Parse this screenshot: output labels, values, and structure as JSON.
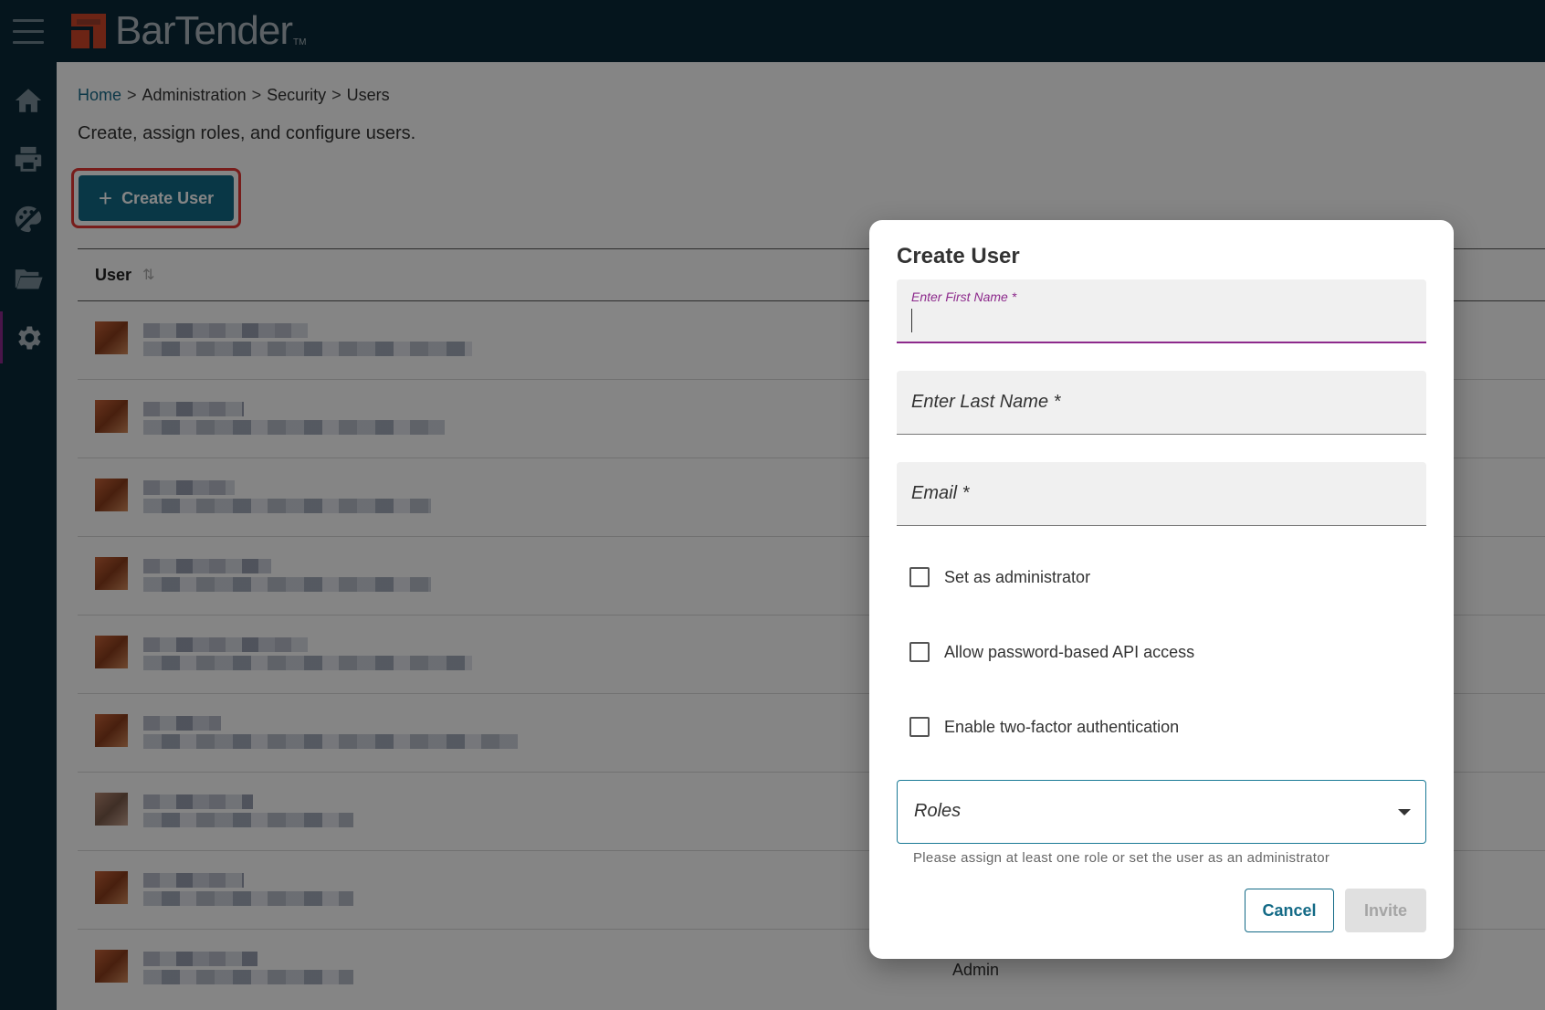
{
  "app": {
    "name": "BarTender",
    "tm": "TM"
  },
  "sidebar": {
    "items": [
      {
        "icon": "home-icon"
      },
      {
        "icon": "printer-icon"
      },
      {
        "icon": "design-palette-icon"
      },
      {
        "icon": "folder-icon"
      },
      {
        "icon": "gear-icon",
        "active": true
      }
    ]
  },
  "breadcrumb": {
    "home": "Home",
    "sep": ">",
    "admin": "Administration",
    "security": "Security",
    "users": "Users"
  },
  "page": {
    "subtitle": "Create, assign roles, and configure users.",
    "create_button_label": "Create User",
    "create_button_plus": "+"
  },
  "table": {
    "column_user": "User",
    "sort_glyph": "⇅",
    "last_row_role": "Admin"
  },
  "dialog": {
    "title": "Create User",
    "first_name_label": "Enter First Name *",
    "last_name_placeholder": "Enter Last Name *",
    "email_placeholder": "Email *",
    "checkbox_admin": "Set as administrator",
    "checkbox_api": "Allow password-based API access",
    "checkbox_2fa": "Enable two-factor authentication",
    "roles_label": "Roles",
    "roles_hint": "Please assign at least one role or set the user as an administrator",
    "cancel_label": "Cancel",
    "invite_label": "Invite"
  },
  "colors": {
    "topbar": "#0b2a38",
    "primary": "#136a86",
    "focus": "#8d2a8c",
    "highlight": "#e53935"
  }
}
